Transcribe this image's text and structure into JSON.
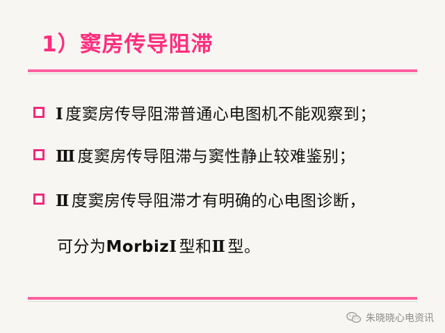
{
  "slide": {
    "title": "1）窦房传导阻滞",
    "bullets": [
      {
        "prefix": "Ⅰ",
        "text": "度窦房传导阻滞普通心电图机不能观察到；"
      },
      {
        "prefix": "Ⅲ",
        "text": "度窦房传导阻滞与窦性静止较难鉴别；"
      },
      {
        "prefix": "Ⅱ",
        "text": "度窦房传导阻滞才有明确的心电图诊断，"
      }
    ],
    "continuation": {
      "part1": "可分为",
      "brand": "Morbiz",
      "type1": "Ⅰ",
      "part2": "型和",
      "type2": "Ⅱ",
      "part3": "型。"
    }
  },
  "watermark": {
    "text": "朱晓晓心电资讯",
    "icon": "wechat-icon"
  },
  "colors": {
    "accent": "#ff2d7e",
    "rule": "#ff5fa0",
    "background": "#f7f6f2"
  }
}
